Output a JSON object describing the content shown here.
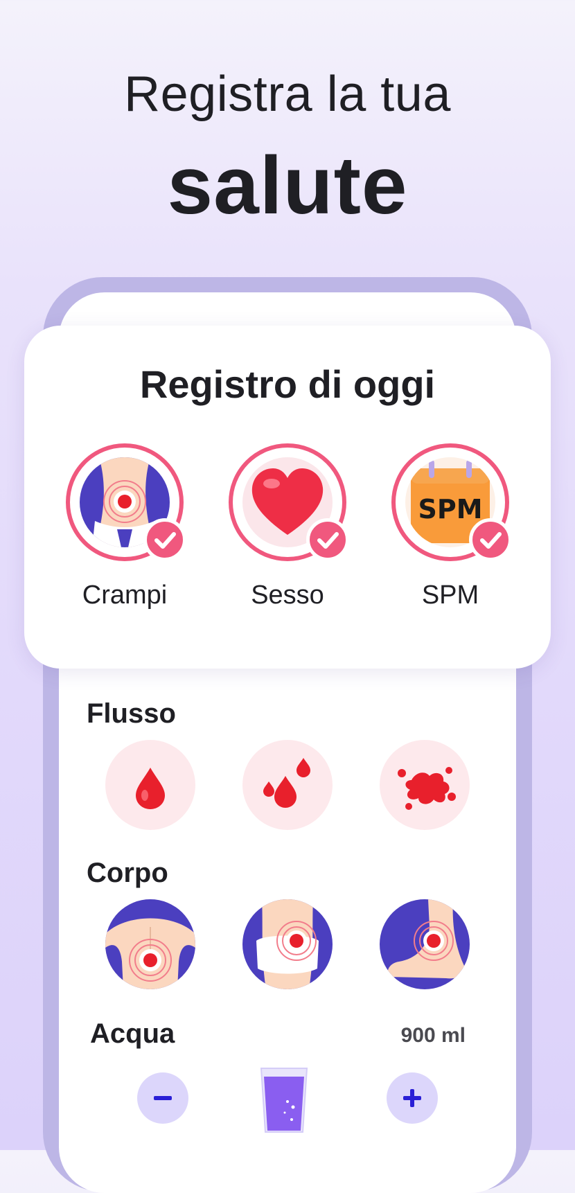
{
  "headline": {
    "line1": "Registra la tua",
    "line2": "salute"
  },
  "card": {
    "title": "Registro di oggi",
    "items": [
      {
        "label": "Crampi",
        "icon": "cramps-icon",
        "checked": true
      },
      {
        "label": "Sesso",
        "icon": "heart-icon",
        "checked": true
      },
      {
        "label": "SPM",
        "icon": "pms-calendar-icon",
        "checked": true,
        "icon_text": "SPM"
      }
    ]
  },
  "flow": {
    "title": "Flusso",
    "options": [
      "flow-light-icon",
      "flow-medium-icon",
      "flow-heavy-icon"
    ]
  },
  "body": {
    "title": "Corpo",
    "options": [
      "back-pain-icon",
      "breast-pain-icon",
      "ankle-pain-icon"
    ]
  },
  "water": {
    "title": "Acqua",
    "amount": "900 ml",
    "minus_label": "−",
    "plus_label": "+"
  },
  "colors": {
    "accent": "#f0587e",
    "purple": "#4b3fbf",
    "flow_red": "#e8202c",
    "control_bg": "#dcd6fb"
  }
}
